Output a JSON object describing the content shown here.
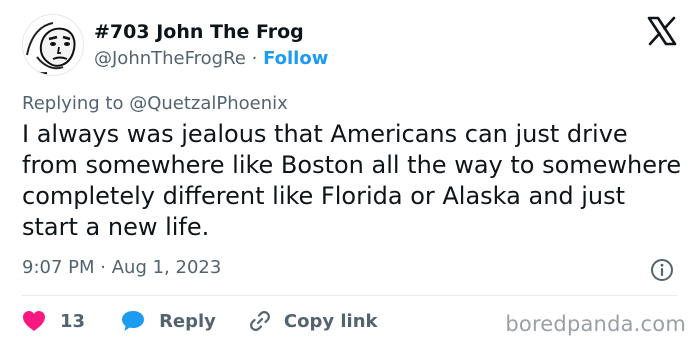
{
  "author": {
    "display_name": "#703 John The Frog",
    "handle": "@JohnTheFrogRe",
    "separator": "·",
    "follow_label": "Follow",
    "avatar_icon": "frog-face-avatar"
  },
  "platform": {
    "logo_icon": "x-logo-icon"
  },
  "tweet": {
    "reply_prefix": "Replying to",
    "reply_handle": "@QuetzalPhoenix",
    "text": "I always was jealous that Americans can just drive from somewhere like Boston all the way to somewhere completely different like Florida or Alaska and just start a new life.",
    "time": "9:07 PM",
    "separator": "·",
    "date": "Aug 1, 2023",
    "info_icon": "info-icon"
  },
  "actions": {
    "like_icon": "heart-icon",
    "like_count": "13",
    "reply_icon": "speech-bubble-icon",
    "reply_label": "Reply",
    "copy_icon": "link-icon",
    "copy_label": "Copy link"
  },
  "watermark": "boredpanda.com",
  "colors": {
    "like": "#f91880",
    "reply": "#1d9bf0",
    "follow": "#1d9bf0",
    "muted": "#536471",
    "text": "#0f1419"
  }
}
